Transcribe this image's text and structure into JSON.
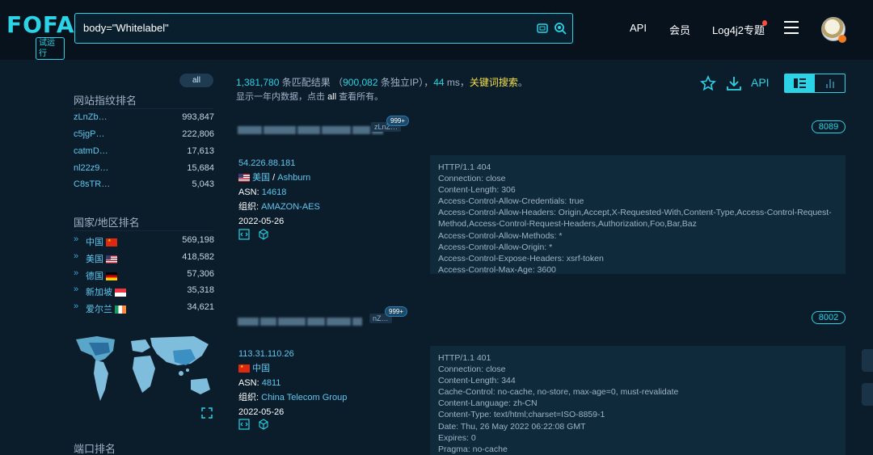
{
  "header": {
    "logo": "FOFA",
    "logo_badge": "试运行",
    "search_value": "body=\"Whitelabel\"",
    "nav": [
      "API",
      "会员",
      "Log4j2专题"
    ]
  },
  "sidebar": {
    "all_label": "all",
    "fingerprint_title": "网站指纹排名",
    "fingerprints": [
      {
        "name": "zLnZb…",
        "count": "993,847"
      },
      {
        "name": "c5jgP…",
        "count": "222,806"
      },
      {
        "name": "catmD…",
        "count": "17,613"
      },
      {
        "name": "nl22z9…",
        "count": "15,684"
      },
      {
        "name": "C8sTR…",
        "count": "5,043"
      }
    ],
    "country_title": "国家/地区排名",
    "countries": [
      {
        "name": "中国",
        "flag": "cn",
        "count": "569,198"
      },
      {
        "name": "美国",
        "flag": "us",
        "count": "418,582"
      },
      {
        "name": "德国",
        "flag": "de",
        "count": "57,306"
      },
      {
        "name": "新加坡",
        "flag": "sg",
        "count": "35,318"
      },
      {
        "name": "爱尔兰",
        "flag": "ie",
        "count": "34,621"
      }
    ],
    "port_title": "端口排名"
  },
  "summary": {
    "total": "1,381,780",
    "total_label": "条匹配结果",
    "ip_open": "（",
    "ips": "900,082",
    "ip_label": "条独立IP）",
    "ms_sep": "，",
    "ms": "44",
    "ms_label": "ms，",
    "keyword": "关键词搜索",
    "keyword_end": "。",
    "line2_pre": "显示一年内数据，点击",
    "line2_all": "all",
    "line2_post": "查看所有。",
    "api": "API"
  },
  "results": [
    {
      "tag": "zLnZ…",
      "badge": "999+",
      "port": "8089",
      "ip": "54.226.88.181",
      "country": "美国",
      "city_sep": "/",
      "city": "Ashburn",
      "asn_label": "ASN:",
      "asn": "14618",
      "org_label": "组织:",
      "org": "AMAZON-AES",
      "date": "2022-05-26",
      "http": [
        "HTTP/1.1 404",
        "Connection: close",
        "Content-Length: 306",
        "Access-Control-Allow-Credentials: true",
        "Access-Control-Allow-Headers: Origin,Accept,X-Requested-With,Content-Type,Access-Control-Request-Method,Access-Control-Request-Headers,Authorization,Foo,Bar,Baz",
        "Access-Control-Allow-Methods: *",
        "Access-Control-Allow-Origin: *",
        "Access-Control-Expose-Headers: xsrf-token",
        "Access-Control-Max-Age: 3600"
      ]
    },
    {
      "tag": "nZ…",
      "badge": "999+",
      "port": "8002",
      "ip": "113.31.110.26",
      "country": "中国",
      "asn_label": "ASN:",
      "asn": "4811",
      "org_label": "组织:",
      "org": "China Telecom Group",
      "date": "2022-05-26",
      "http": [
        "HTTP/1.1 401",
        "Connection: close",
        "Content-Length: 344",
        "Cache-Control: no-cache, no-store, max-age=0, must-revalidate",
        "Content-Language: zh-CN",
        "Content-Type: text/html;charset=ISO-8859-1",
        "Date: Thu, 26 May 2022 06:22:08 GMT",
        "Expires: 0",
        "Pragma: no-cache"
      ]
    }
  ],
  "colors": {
    "accent": "#2ad4e6",
    "background": "#0b1c2a",
    "panel": "#0f2a3a",
    "highlight": "#f5e050"
  }
}
